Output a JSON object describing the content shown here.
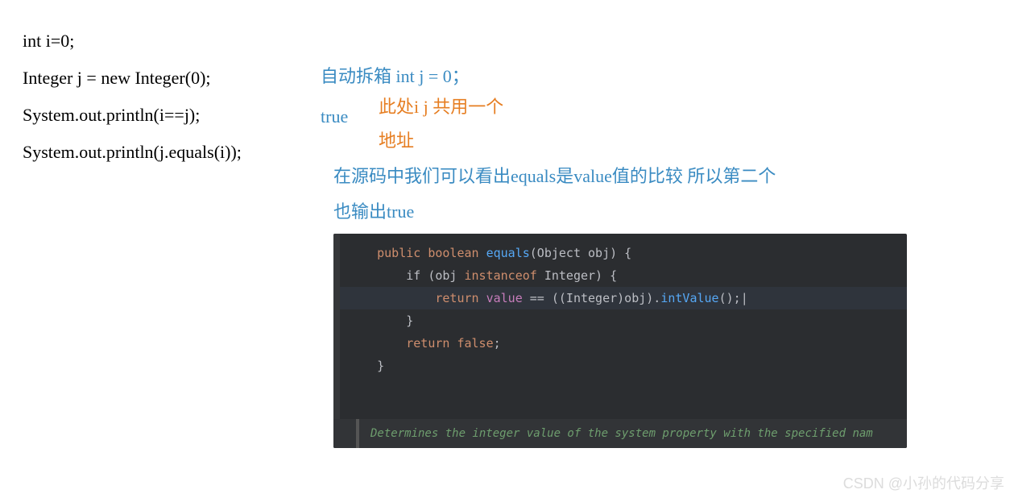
{
  "code_lines": {
    "l1": "int i=0;",
    "l2": "Integer j = new Integer(0);",
    "l3": "System.out.println(i==j);",
    "l4": "System.out.println(j.equals(i));"
  },
  "annotations": {
    "auto_unboxing": "自动拆箱  int j = 0；",
    "true_label": "true",
    "addr_line1": "此处i j 共用一个",
    "addr_line2": "地址",
    "equals_explain_line1": "在源码中我们可以看出equals是value值的比较 所以第二个",
    "equals_explain_line2": "也输出true"
  },
  "editor": {
    "tokens": {
      "public": "public",
      "boolean": "boolean",
      "equals": "equals",
      "obj_param": "(Object obj) {",
      "if_prefix": "        if (obj ",
      "instanceof": "instanceof",
      "integer_cond": " Integer) {",
      "return1": "            return ",
      "value": "value",
      "eq_op": " == ((Integer)obj).",
      "intValue": "intValue",
      "tail1": "();",
      "cursor": "|",
      "close1": "        }",
      "return2": "        return ",
      "false": "false",
      "semicolon": ";",
      "close2": "    }"
    },
    "doc": "Determines the integer value of the system property with the specified nam"
  },
  "watermark": "CSDN @小孙的代码分享"
}
